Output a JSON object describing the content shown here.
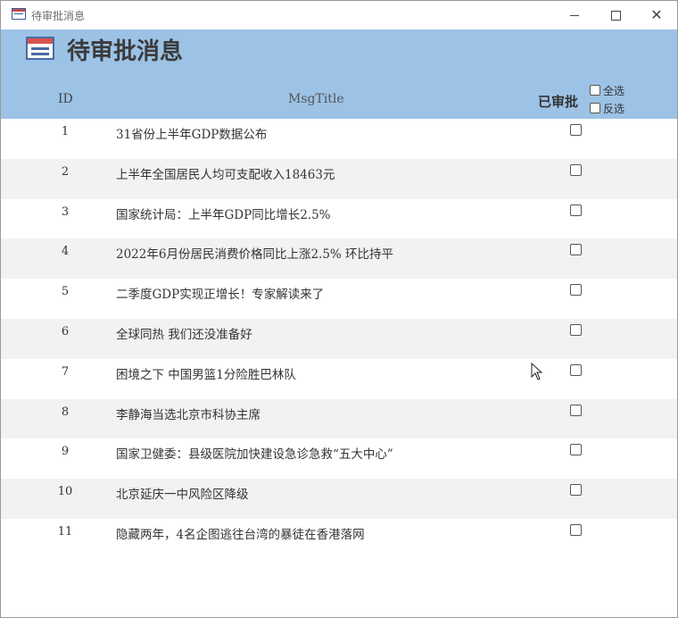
{
  "window": {
    "title": "待审批消息"
  },
  "form": {
    "title": "待审批消息",
    "columns": {
      "id": "ID",
      "title": "MsgTitle",
      "approved": "已审批"
    },
    "select_all": "全选",
    "invert_select": "反选"
  },
  "rows": [
    {
      "id": "1",
      "title": "31省份上半年GDP数据公布",
      "approved": false
    },
    {
      "id": "2",
      "title": "上半年全国居民人均可支配收入18463元",
      "approved": false
    },
    {
      "id": "3",
      "title": "国家统计局：上半年GDP同比增长2.5%",
      "approved": false
    },
    {
      "id": "4",
      "title": "2022年6月份居民消费价格同比上涨2.5% 环比持平",
      "approved": false
    },
    {
      "id": "5",
      "title": "二季度GDP实现正增长！专家解读来了",
      "approved": false
    },
    {
      "id": "6",
      "title": "全球同热 我们还没准备好",
      "approved": false
    },
    {
      "id": "7",
      "title": "困境之下 中国男篮1分险胜巴林队",
      "approved": false
    },
    {
      "id": "8",
      "title": "李静海当选北京市科协主席",
      "approved": false
    },
    {
      "id": "9",
      "title": "国家卫健委：县级医院加快建设急诊急救“五大中心”",
      "approved": false
    },
    {
      "id": "10",
      "title": "北京延庆一中风险区降级",
      "approved": false
    },
    {
      "id": "11",
      "title": "隐藏两年，4名企图逃往台湾的暴徒在香港落网",
      "approved": false
    }
  ],
  "colors": {
    "header_bg": "#9cc2e5",
    "alt_row_bg": "#f2f2f2"
  }
}
